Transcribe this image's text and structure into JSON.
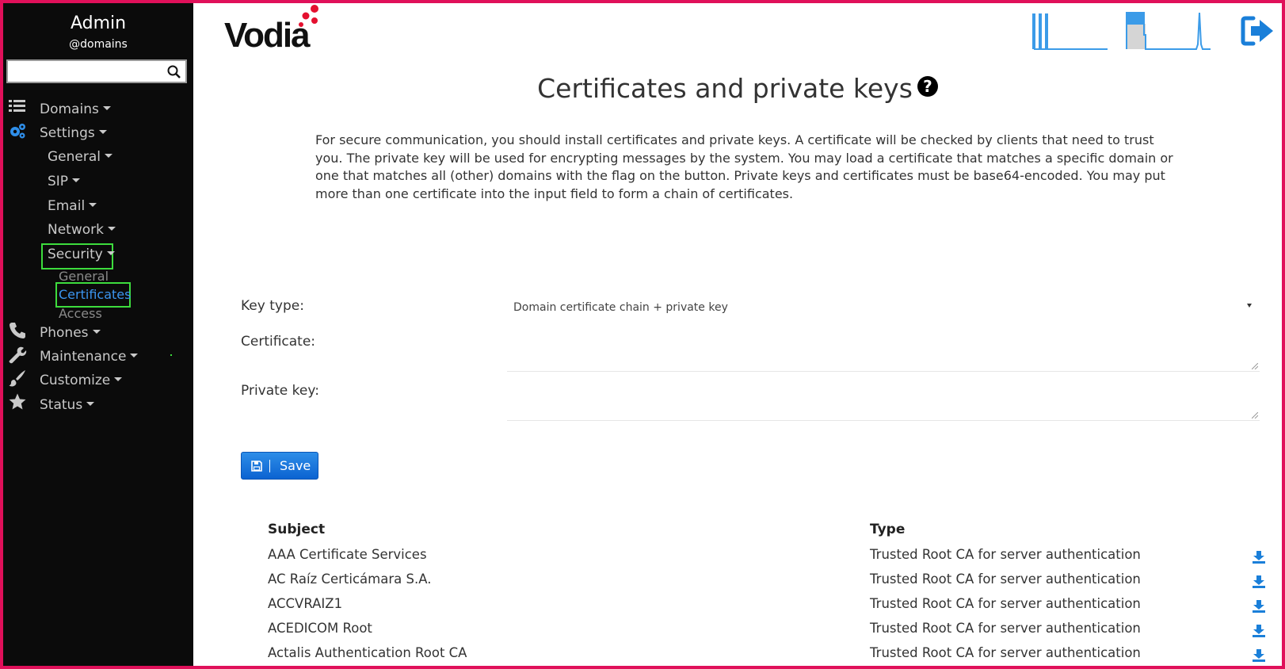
{
  "sidebar": {
    "title": "Admin",
    "subtitle": "@domains",
    "search_value": "",
    "nav": {
      "domains": "Domains",
      "settings": "Settings",
      "general": "General",
      "sip": "SIP",
      "email": "Email",
      "network": "Network",
      "security": "Security",
      "security_general": "General",
      "certificates": "Certificates",
      "access": "Access",
      "phones": "Phones",
      "maintenance": "Maintenance",
      "customize": "Customize",
      "status": "Status"
    }
  },
  "header": {
    "logo": "Vodia"
  },
  "page": {
    "title": "Certificates and private keys",
    "help_icon": "?",
    "description": "For secure communication, you should install certificates and private keys. A certificate will be checked by clients that need to trust you. The private key will be used for encrypting messages by the system. You may load a certificate that matches a specific domain or one that matches all (other) domains with the flag on the button. Private keys and certificates must be base64-encoded. You may put more than one certificate into the input field to form a chain of certificates."
  },
  "form": {
    "key_type_label": "Key type:",
    "key_type_value": "Domain certificate chain + private key",
    "certificate_label": "Certificate:",
    "private_key_label": "Private key:",
    "save_label": "Save"
  },
  "table": {
    "headers": [
      "Subject",
      "Type"
    ],
    "rows": [
      {
        "subject": "AAA Certificate Services",
        "type": "Trusted Root CA for server authentication"
      },
      {
        "subject": "AC Raíz Certicámara S.A.",
        "type": "Trusted Root CA for server authentication"
      },
      {
        "subject": "ACCVRAIZ1",
        "type": "Trusted Root CA for server authentication"
      },
      {
        "subject": "ACEDICOM Root",
        "type": "Trusted Root CA for server authentication"
      },
      {
        "subject": "Actalis Authentication Root CA",
        "type": "Trusted Root CA for server authentication"
      }
    ]
  },
  "colors": {
    "accent": "#1a7fd9",
    "sidebar_bg": "#0b0b0b",
    "highlight": "#3ddc3d",
    "frame": "#e0105a"
  }
}
